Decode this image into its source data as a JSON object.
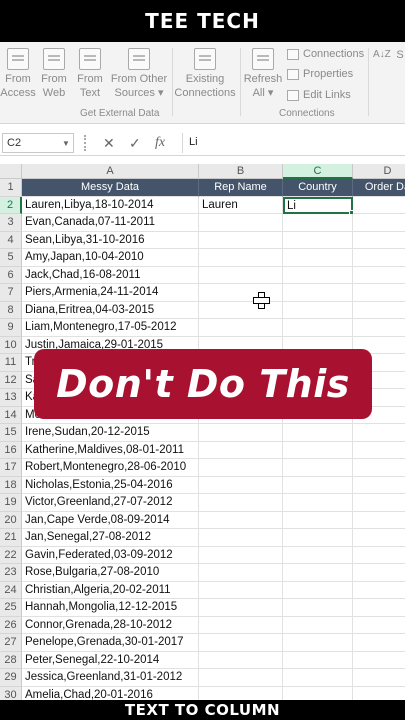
{
  "banner": {
    "top": "TEE TECH",
    "bottom": "TEXT TO COLUMN"
  },
  "ribbon": {
    "buttons": [
      {
        "line1": "From",
        "line2": "Access"
      },
      {
        "line1": "From",
        "line2": "Web"
      },
      {
        "line1": "From",
        "line2": "Text"
      },
      {
        "line1": "From Other",
        "line2": "Sources ▾"
      },
      {
        "line1": "Existing",
        "line2": "Connections"
      },
      {
        "line1": "Refresh",
        "line2": "All ▾"
      }
    ],
    "group_external": "Get External Data",
    "group_connections": "Connections",
    "connections_items": [
      "Connections",
      "Properties",
      "Edit Links"
    ],
    "sort_icons": [
      "A↓Z",
      "S"
    ]
  },
  "formula_bar": {
    "name_box": "C2",
    "cancel_symbol": "✕",
    "enter_symbol": "✓",
    "fx_symbol": "fx",
    "value": "Li"
  },
  "grid": {
    "columns": [
      "A",
      "B",
      "C",
      "D"
    ],
    "headers": [
      "Messy Data",
      "Rep Name",
      "Country",
      "Order Da"
    ],
    "rows": [
      {
        "n": "2",
        "a": "Lauren,Libya,18-10-2014",
        "b": "Lauren",
        "c": "Li"
      },
      {
        "n": "3",
        "a": "Evan,Canada,07-11-2011"
      },
      {
        "n": "4",
        "a": "Sean,Libya,31-10-2016"
      },
      {
        "n": "5",
        "a": "Amy,Japan,10-04-2010"
      },
      {
        "n": "6",
        "a": "Jack,Chad,16-08-2011"
      },
      {
        "n": "7",
        "a": "Piers,Armenia,24-11-2014"
      },
      {
        "n": "8",
        "a": "Diana,Eritrea,04-03-2015"
      },
      {
        "n": "9",
        "a": "Liam,Montenegro,17-05-2012"
      },
      {
        "n": "10",
        "a": "Justin,Jamaica,29-01-2015"
      },
      {
        "n": "11",
        "a": "Tr"
      },
      {
        "n": "12",
        "a": "Sa"
      },
      {
        "n": "13",
        "a": "Ka"
      },
      {
        "n": "14",
        "a": "Mc"
      },
      {
        "n": "15",
        "a": "Irene,Sudan,20-12-2015"
      },
      {
        "n": "16",
        "a": "Katherine,Maldives,08-01-2011"
      },
      {
        "n": "17",
        "a": "Robert,Montenegro,28-06-2010"
      },
      {
        "n": "18",
        "a": "Nicholas,Estonia,25-04-2016"
      },
      {
        "n": "19",
        "a": "Victor,Greenland,27-07-2012"
      },
      {
        "n": "20",
        "a": "Jan,Cape Verde,08-09-2014"
      },
      {
        "n": "21",
        "a": "Jan,Senegal,27-08-2012"
      },
      {
        "n": "22",
        "a": "Gavin,Federated,03-09-2012"
      },
      {
        "n": "23",
        "a": "Rose,Bulgaria,27-08-2010"
      },
      {
        "n": "24",
        "a": "Christian,Algeria,20-02-2011"
      },
      {
        "n": "25",
        "a": "Hannah,Mongolia,12-12-2015"
      },
      {
        "n": "26",
        "a": "Connor,Grenada,28-10-2012"
      },
      {
        "n": "27",
        "a": "Penelope,Grenada,30-01-2017"
      },
      {
        "n": "28",
        "a": "Peter,Senegal,22-10-2014"
      },
      {
        "n": "29",
        "a": "Jessica,Greenland,31-01-2012"
      },
      {
        "n": "30",
        "a": "Amelia,Chad,20-01-2016"
      }
    ]
  },
  "overlay": {
    "text": "Don't Do This"
  },
  "colors": {
    "header_fill": "#44546a",
    "accent_green": "#217346",
    "overlay_red": "#a8112f"
  }
}
